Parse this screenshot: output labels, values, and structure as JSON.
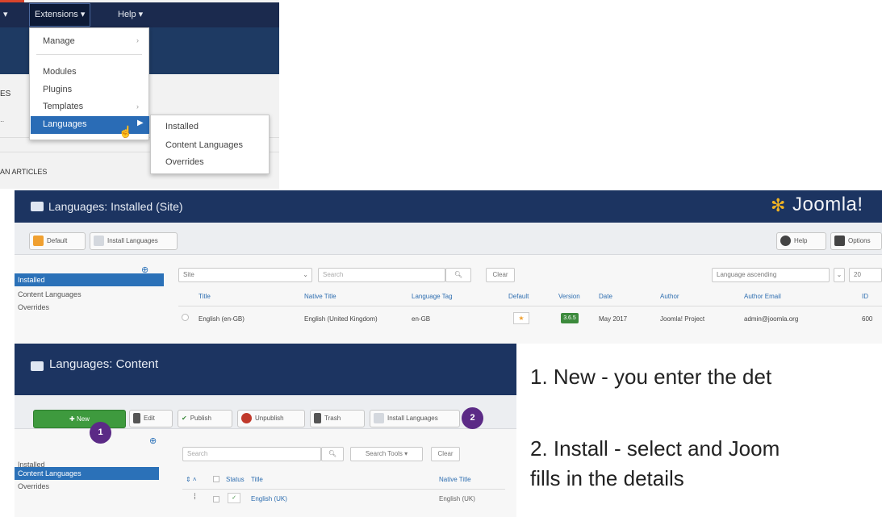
{
  "menu_screenshot": {
    "nav": {
      "extensions_label": "Extensions ▾",
      "help_label": "Help ▾",
      "left_caret": "▾"
    },
    "extensions_menu": {
      "items": [
        "Manage",
        "Modules",
        "Plugins",
        "Templates",
        "Languages"
      ],
      "arrow": "›"
    },
    "languages_submenu": {
      "items": [
        "Installed",
        "Content Languages",
        "Overrides"
      ]
    },
    "left_edge_labels": [
      "ES",
      "",
      "AN ARTICLES"
    ]
  },
  "installed_screenshot": {
    "title": "Languages: Installed (Site)",
    "brand": "Joomla!",
    "toolbar": {
      "default_label": "Default",
      "install_label": "Install Languages",
      "help_label": "Help",
      "options_label": "Options"
    },
    "sidebar": {
      "items": [
        "Installed",
        "Content Languages",
        "Overrides"
      ],
      "active_index": 0
    },
    "filters": {
      "client_value": "Site",
      "search_placeholder": "Search",
      "clear_label": "Clear",
      "sort_value": "Language ascending",
      "limit_value": "20"
    },
    "table": {
      "columns": [
        "Title",
        "Native Title",
        "Language Tag",
        "Default",
        "Version",
        "Date",
        "Author",
        "Author Email",
        "ID"
      ],
      "rows": [
        {
          "title": "English (en-GB)",
          "native_title": "English (United Kingdom)",
          "tag": "en-GB",
          "default": "★",
          "version": "3.6.5",
          "date": "May 2017",
          "author": "Joomla! Project",
          "email": "admin@joomla.org",
          "id": "600"
        }
      ]
    }
  },
  "content_screenshot": {
    "title": "Languages: Content",
    "toolbar": {
      "new_label": "New",
      "edit_label": "Edit",
      "publish_label": "Publish",
      "unpublish_label": "Unpublish",
      "trash_label": "Trash",
      "install_label": "Install Languages",
      "badge_1": "1",
      "badge_2": "2"
    },
    "sidebar": {
      "items": [
        "Installed",
        "Content Languages",
        "Overrides"
      ],
      "active_index": 1
    },
    "filters": {
      "search_placeholder": "Search",
      "search_tools_label": "Search Tools ▾",
      "clear_label": "Clear"
    },
    "table": {
      "columns": [
        "Status",
        "Title",
        "Native Title"
      ],
      "rows": [
        {
          "order": "⁞",
          "status": "✓",
          "title": "English (UK)",
          "native_title": "English (UK)"
        }
      ]
    }
  },
  "notes": {
    "line1": "1. New - you enter the det",
    "line2a": "2. Install - select and Joom",
    "line2b": "fills in the details"
  },
  "colors": {
    "nav_dark": "#1b2a4e",
    "header_blue": "#1c3461",
    "active_blue": "#2b71b8",
    "new_green": "#3e9a3e",
    "badge_purple": "#5b2a86"
  }
}
